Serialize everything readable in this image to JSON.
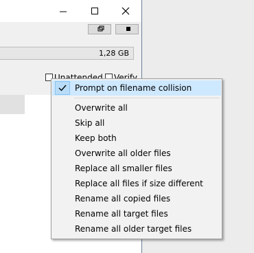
{
  "window": {
    "disk_size": "1,28 GB",
    "unattended_label": "Unattended",
    "verify_label": "Verify"
  },
  "menu": {
    "checked_item": "Prompt on filename collision",
    "items": [
      "Overwrite all",
      "Skip all",
      "Keep both",
      "Overwrite all older files",
      "Replace all smaller files",
      "Replace all files if size different",
      "Rename all copied files",
      "Rename all target files",
      "Rename all older target files"
    ]
  },
  "colors": {
    "highlight": "#cde8ff",
    "menu_bg": "#f2f2f2"
  }
}
